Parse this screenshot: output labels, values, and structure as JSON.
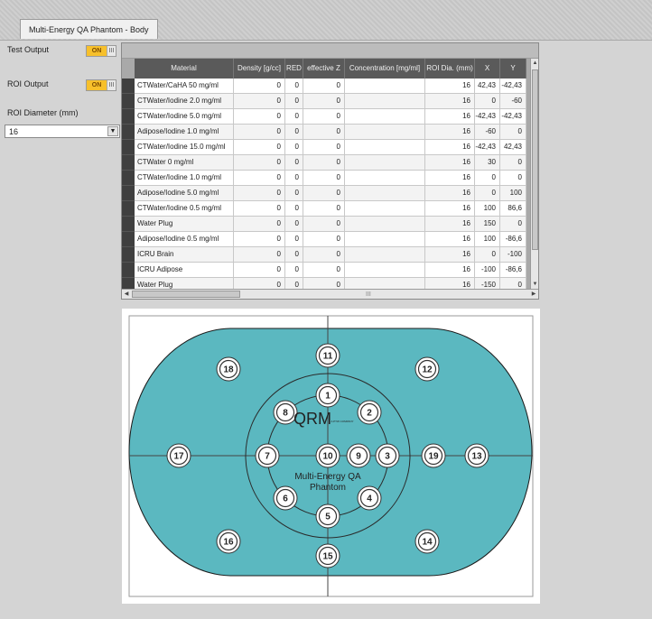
{
  "tab": {
    "label": "Multi-Energy QA Phantom - Body"
  },
  "controls": {
    "test_output_label": "Test Output",
    "roi_output_label": "ROI Output",
    "toggle_on": "ON",
    "toggle_bars": "III",
    "roi_diameter_label": "ROI Diameter (mm)",
    "roi_diameter_value": "16"
  },
  "table": {
    "columns": [
      "Material",
      "Density [g/cc]",
      "RED",
      "effective Z",
      "Concentration [mg/ml]",
      "ROI Dia. (mm)",
      "X",
      "Y"
    ],
    "rows": [
      {
        "material": "CTWater/CaHA 50 mg/ml",
        "density": "0",
        "red": "0",
        "effz": "0",
        "conc": "",
        "roi": "16",
        "x": "42,43",
        "y": "-42,43"
      },
      {
        "material": "CTWater/Iodine 2.0 mg/ml",
        "density": "0",
        "red": "0",
        "effz": "0",
        "conc": "",
        "roi": "16",
        "x": "0",
        "y": "-60"
      },
      {
        "material": "CTWater/Iodine 5.0 mg/ml",
        "density": "0",
        "red": "0",
        "effz": "0",
        "conc": "",
        "roi": "16",
        "x": "-42,43",
        "y": "-42,43"
      },
      {
        "material": "Adipose/Iodine 1.0 mg/ml",
        "density": "0",
        "red": "0",
        "effz": "0",
        "conc": "",
        "roi": "16",
        "x": "-60",
        "y": "0"
      },
      {
        "material": "CTWater/Iodine 15.0 mg/ml",
        "density": "0",
        "red": "0",
        "effz": "0",
        "conc": "",
        "roi": "16",
        "x": "-42,43",
        "y": "42,43"
      },
      {
        "material": "CTWater 0 mg/ml",
        "density": "0",
        "red": "0",
        "effz": "0",
        "conc": "",
        "roi": "16",
        "x": "30",
        "y": "0"
      },
      {
        "material": "CTWater/Iodine 1.0 mg/ml",
        "density": "0",
        "red": "0",
        "effz": "0",
        "conc": "",
        "roi": "16",
        "x": "0",
        "y": "0"
      },
      {
        "material": "Adipose/Iodine 5.0 mg/ml",
        "density": "0",
        "red": "0",
        "effz": "0",
        "conc": "",
        "roi": "16",
        "x": "0",
        "y": "100"
      },
      {
        "material": "CTWater/Iodine 0.5 mg/ml",
        "density": "0",
        "red": "0",
        "effz": "0",
        "conc": "",
        "roi": "16",
        "x": "100",
        "y": "86,6"
      },
      {
        "material": "Water Plug",
        "density": "0",
        "red": "0",
        "effz": "0",
        "conc": "",
        "roi": "16",
        "x": "150",
        "y": "0"
      },
      {
        "material": "Adipose/Iodine 0.5 mg/ml",
        "density": "0",
        "red": "0",
        "effz": "0",
        "conc": "",
        "roi": "16",
        "x": "100",
        "y": "-86,6"
      },
      {
        "material": "ICRU Brain",
        "density": "0",
        "red": "0",
        "effz": "0",
        "conc": "",
        "roi": "16",
        "x": "0",
        "y": "-100"
      },
      {
        "material": "ICRU Adipose",
        "density": "0",
        "red": "0",
        "effz": "0",
        "conc": "",
        "roi": "16",
        "x": "-100",
        "y": "-86,6"
      },
      {
        "material": "Water Plug",
        "density": "0",
        "red": "0",
        "effz": "0",
        "conc": "",
        "roi": "16",
        "x": "-150",
        "y": "0"
      }
    ]
  },
  "scroll": {
    "grip": "III"
  },
  "phantom": {
    "fill_color": "#5bb8c0",
    "logo": "QRM",
    "logo_small": "A PTW COMPANY",
    "title_line1": "Multi-Energy QA",
    "title_line2": "Phantom",
    "inserts": [
      "1",
      "2",
      "3",
      "4",
      "5",
      "6",
      "7",
      "8",
      "9",
      "10",
      "11",
      "12",
      "13",
      "14",
      "15",
      "16",
      "17",
      "18",
      "19"
    ]
  }
}
